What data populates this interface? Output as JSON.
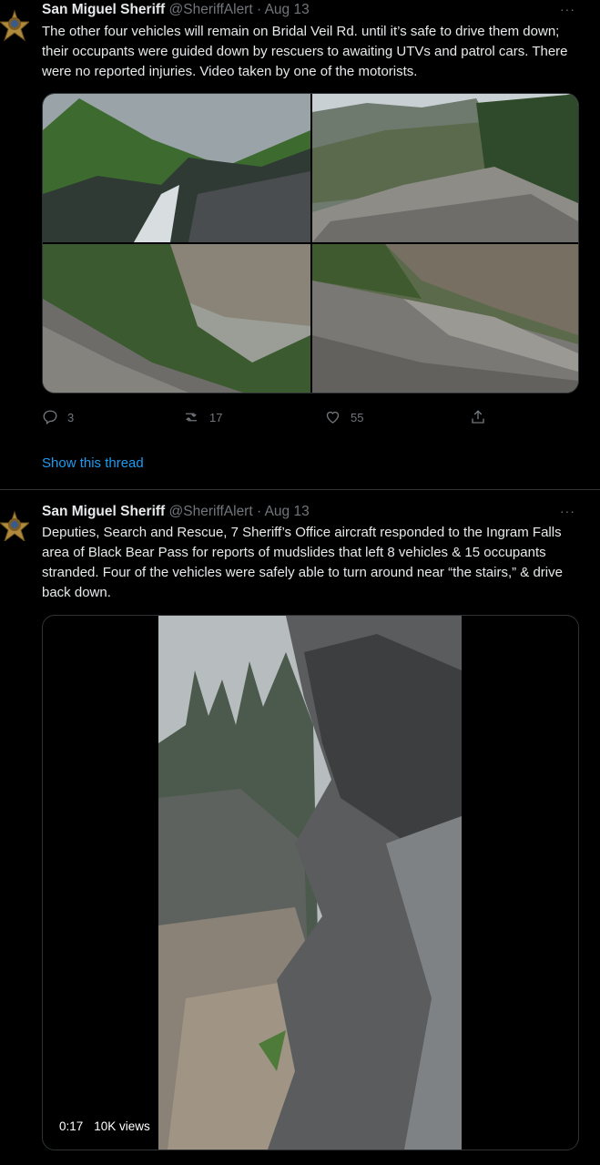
{
  "tweets": [
    {
      "author_name": "San Miguel Sheriff",
      "handle": "@SheriffAlert",
      "date": "Aug 13",
      "separator": "·",
      "more": "···",
      "text": "The other four vehicles will remain on Bridal Veil Rd. until it’s safe to drive them down; their occupants were guided down by rescuers to awaiting UTVs and patrol cars. There were no reported injuries. Video taken by one of the motorists.",
      "actions": {
        "replies": "3",
        "retweets": "17",
        "likes": "55"
      },
      "show_thread": "Show this thread"
    },
    {
      "author_name": "San Miguel Sheriff",
      "handle": "@SheriffAlert",
      "date": "Aug 13",
      "separator": "·",
      "more": "···",
      "text": "Deputies, Search and Rescue, 7 Sheriff’s Office aircraft responded to the Ingram Falls area of Black Bear Pass for reports of mudslides that left 8 vehicles & 15 occupants stranded. Four of the vehicles were safely able to turn around near “the stairs,” & drive back down.",
      "video": {
        "duration": "0:17",
        "views": "10K views"
      }
    }
  ],
  "colors": {
    "background": "#000000",
    "text": "#e7e9ea",
    "muted": "#71767b",
    "link": "#1d9bf0",
    "border": "#2f3336"
  },
  "icons": [
    "sheriff-badge-icon",
    "more-icon",
    "reply-icon",
    "retweet-icon",
    "like-icon",
    "share-icon"
  ]
}
